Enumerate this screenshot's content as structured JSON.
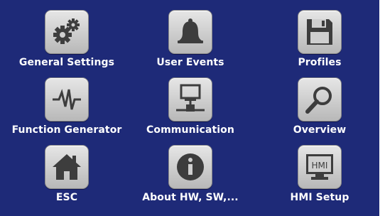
{
  "menu": {
    "items": [
      {
        "label": "General Settings",
        "icon": "gears-icon"
      },
      {
        "label": "User Events",
        "icon": "bell-icon"
      },
      {
        "label": "Profiles",
        "icon": "floppy-disk-icon"
      },
      {
        "label": "Function Generator",
        "icon": "waveform-icon"
      },
      {
        "label": "Communication",
        "icon": "network-computer-icon"
      },
      {
        "label": "Overview",
        "icon": "magnifier-icon"
      },
      {
        "label": "ESC",
        "icon": "home-icon"
      },
      {
        "label": "About HW, SW,...",
        "icon": "info-icon"
      },
      {
        "label": "HMI Setup",
        "icon": "monitor-hmi-icon",
        "icon_text": "HMI"
      }
    ]
  },
  "colors": {
    "background": "#1e2a78",
    "icon_fill": "#3d3d3d",
    "tile": "#cfcfcf",
    "text": "#ffffff"
  }
}
